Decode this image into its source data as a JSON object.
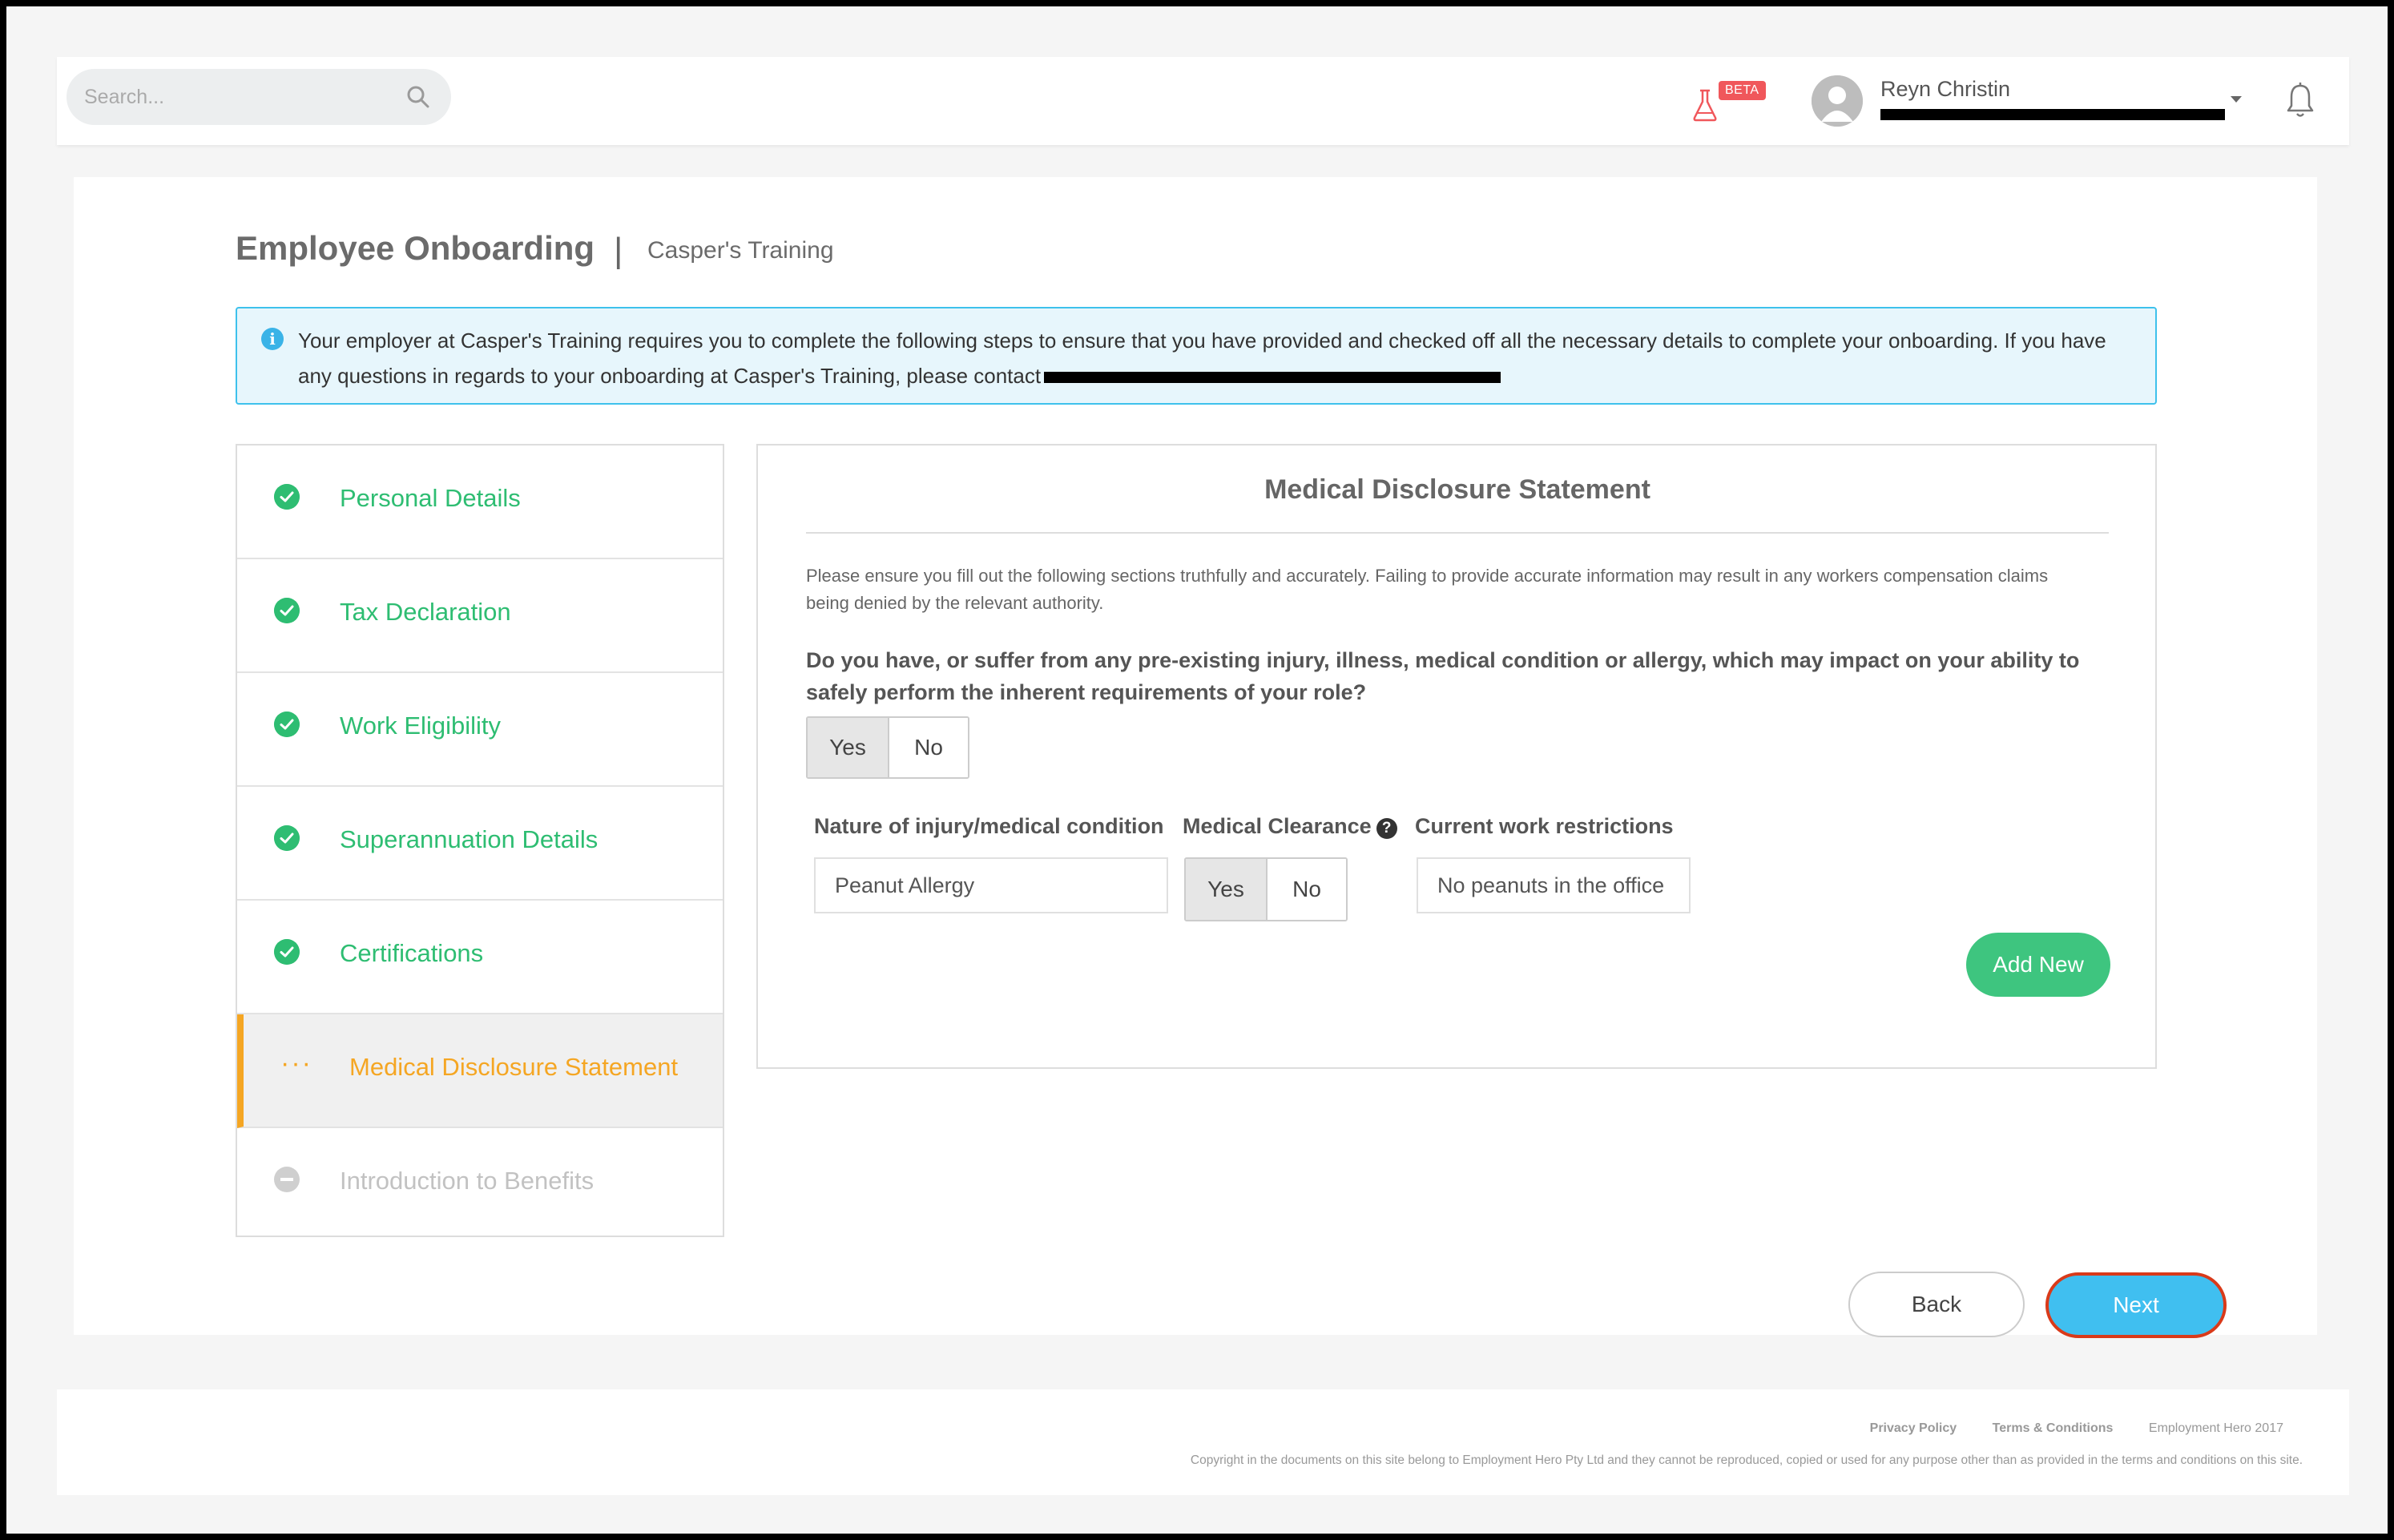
{
  "header": {
    "search_placeholder": "Search...",
    "beta_label": "BETA",
    "user_name": "Reyn Christin"
  },
  "page": {
    "title": "Employee Onboarding",
    "separator": "|",
    "company": "Casper's Training"
  },
  "info": {
    "text": "Your employer at Casper's Training requires you to complete the following steps to ensure that you have provided and checked off all the necessary details to complete your onboarding. If you have any questions in regards to your onboarding at Casper's Training, please contact"
  },
  "steps": [
    {
      "label": "Personal Details",
      "status": "complete"
    },
    {
      "label": "Tax Declaration",
      "status": "complete"
    },
    {
      "label": "Work Eligibility",
      "status": "complete"
    },
    {
      "label": "Superannuation Details",
      "status": "complete"
    },
    {
      "label": "Certifications",
      "status": "complete"
    },
    {
      "label": "Medical Disclosure Statement",
      "status": "in-progress",
      "marker": "···"
    },
    {
      "label": "Introduction to Benefits",
      "status": "pending"
    }
  ],
  "form": {
    "title": "Medical Disclosure Statement",
    "intro": "Please ensure you fill out the following sections truthfully and accurately. Failing to provide accurate information may result in any workers compensation claims being denied by the relevant authority.",
    "question": "Do you have, or suffer from any pre-existing injury, illness, medical condition or allergy, which may impact on your ability to safely perform the inherent requirements of your role?",
    "answer_yes": "Yes",
    "answer_no": "No",
    "answer_selected": "Yes",
    "columns": {
      "nature": "Nature of injury/medical condition",
      "clearance": "Medical Clearance",
      "restrictions": "Current work restrictions"
    },
    "row": {
      "nature_value": "Peanut Allergy",
      "clearance_yes": "Yes",
      "clearance_no": "No",
      "clearance_selected": "Yes",
      "restrictions_value": "No peanuts in the office"
    },
    "add_new_label": "Add New"
  },
  "nav": {
    "back_label": "Back",
    "next_label": "Next"
  },
  "footer": {
    "privacy": "Privacy Policy",
    "terms": "Terms & Conditions",
    "brand": "Employment Hero 2017",
    "copyright": "Copyright in the documents on this site belong to Employment Hero Pty Ltd and they cannot be reproduced, copied or used for any purpose other than as provided in the terms and conditions on this site."
  },
  "colors": {
    "success": "#2ebd72",
    "active": "#f5a623",
    "info": "#3ec1ec",
    "next_button": "#40bff0",
    "add_button": "#3ec57f"
  }
}
